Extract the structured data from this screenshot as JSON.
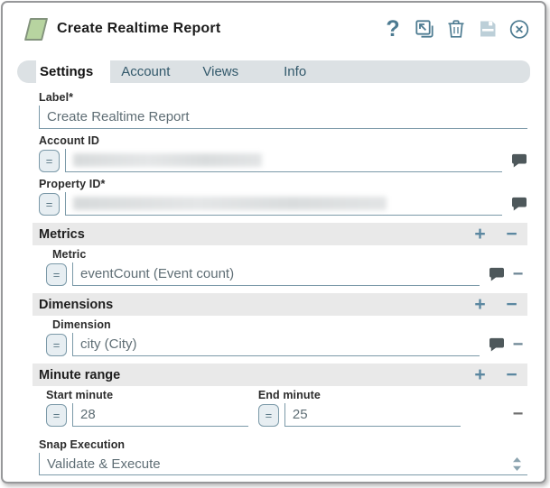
{
  "glyphs": {
    "help": "?",
    "equals": "=",
    "plus": "+",
    "minus": "−"
  },
  "header": {
    "title": "Create Realtime Report"
  },
  "tabs": {
    "active": "Settings",
    "items": [
      {
        "label": "Settings"
      },
      {
        "label": "Account"
      },
      {
        "label": "Views"
      },
      {
        "label": "Info"
      }
    ]
  },
  "fields": {
    "label": {
      "label": "Label*",
      "value": "Create Realtime Report"
    },
    "account_id": {
      "label": "Account ID",
      "redacted": true
    },
    "property_id": {
      "label": "Property ID*",
      "redacted": true
    }
  },
  "sections": {
    "metrics": {
      "title": "Metrics",
      "field_label": "Metric",
      "field_value": "eventCount (Event count)"
    },
    "dimensions": {
      "title": "Dimensions",
      "field_label": "Dimension",
      "field_value": "city (City)"
    },
    "minute_range": {
      "title": "Minute range",
      "start_label": "Start minute",
      "start_value": "28",
      "end_label": "End minute",
      "end_value": "25"
    }
  },
  "snap_execution": {
    "label": "Snap Execution",
    "value": "Validate & Execute"
  },
  "colors": {
    "accent": "#4d7b91",
    "accent_disabled": "#bccfd8",
    "section_header_bg": "#e9e9e9",
    "tab_bar_bg": "#dce1e4",
    "snap_icon_green": "#b7d4a0",
    "input_border": "#7b99a8",
    "comment_bubble": "#4e585b"
  }
}
